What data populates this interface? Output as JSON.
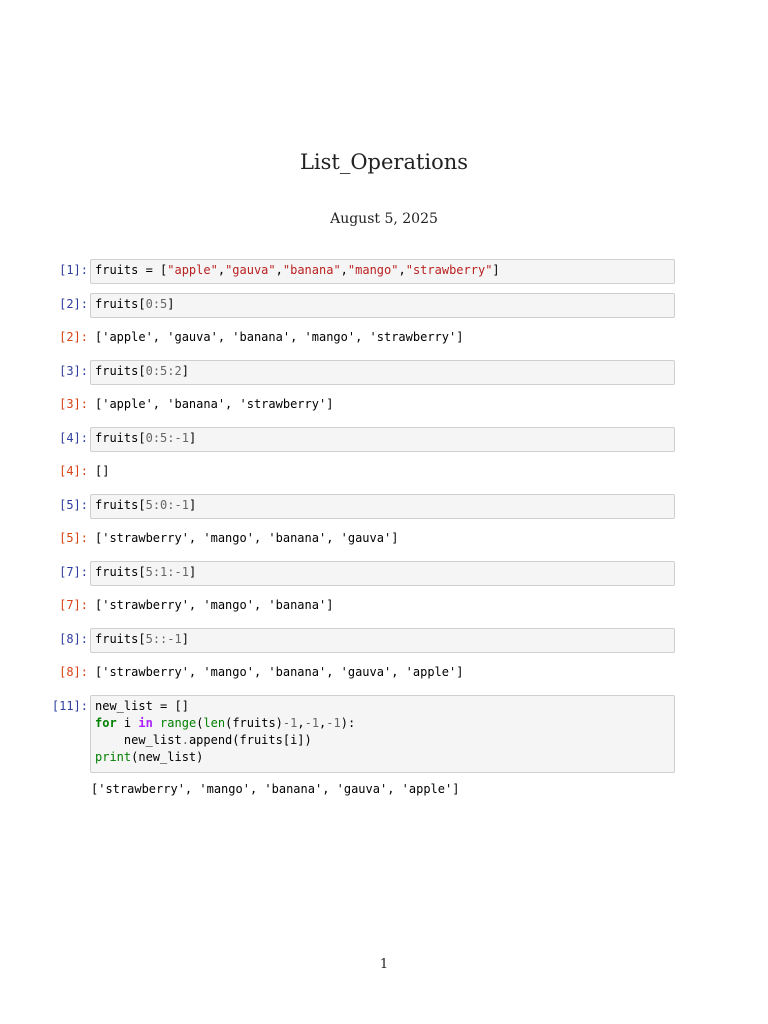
{
  "document": {
    "title": "List_Operations",
    "date": "August 5, 2025",
    "page_number": "1"
  },
  "cells": [
    {
      "in_prompt": "[1]:",
      "code_parts": [
        "fruits = [",
        "\"apple\"",
        ",",
        "\"gauva\"",
        ",",
        "\"banana\"",
        ",",
        "\"mango\"",
        ",",
        "\"strawberry\"",
        "]"
      ]
    },
    {
      "in_prompt": "[2]:",
      "code_parts": [
        "fruits[",
        "0",
        ":",
        "5",
        "]"
      ],
      "out_prompt": "[2]:",
      "output": "['apple', 'gauva', 'banana', 'mango', 'strawberry']"
    },
    {
      "in_prompt": "[3]:",
      "code_parts": [
        "fruits[",
        "0",
        ":",
        "5",
        ":",
        "2",
        "]"
      ],
      "out_prompt": "[3]:",
      "output": "['apple', 'banana', 'strawberry']"
    },
    {
      "in_prompt": "[4]:",
      "code_parts": [
        "fruits[",
        "0",
        ":",
        "5",
        ":",
        "-1",
        "]"
      ],
      "out_prompt": "[4]:",
      "output": "[]"
    },
    {
      "in_prompt": "[5]:",
      "code_parts": [
        "fruits[",
        "5",
        ":",
        "0",
        ":",
        "-1",
        "]"
      ],
      "out_prompt": "[5]:",
      "output": "['strawberry', 'mango', 'banana', 'gauva']"
    },
    {
      "in_prompt": "[7]:",
      "code_parts": [
        "fruits[",
        "5",
        ":",
        "1",
        ":",
        "-1",
        "]"
      ],
      "out_prompt": "[7]:",
      "output": "['strawberry', 'mango', 'banana']"
    },
    {
      "in_prompt": "[8]:",
      "code_parts": [
        "fruits[",
        "5",
        "::",
        "-1",
        "]"
      ],
      "out_prompt": "[8]:",
      "output": "['strawberry', 'mango', 'banana', 'gauva', 'apple']"
    },
    {
      "in_prompt": "[11]:",
      "lines": {
        "l1": "new_list = []",
        "l2_for": "for",
        "l2_i": " i ",
        "l2_in": "in",
        "l2_range": " range",
        "l2_open": "(",
        "l2_len": "len",
        "l2_rest": "(fruits)",
        "l2_n1": "-1",
        "l2_c1": ",",
        "l2_n2": "-1",
        "l2_c2": ",",
        "l2_n3": "-1",
        "l2_end": "):",
        "l3_a": "    new_list",
        "l3_dot": ".",
        "l3_b": "append(fruits[i])",
        "l4_print": "print",
        "l4_rest": "(new_list)"
      },
      "stream_output": "['strawberry', 'mango', 'banana', 'gauva', 'apple']"
    }
  ]
}
